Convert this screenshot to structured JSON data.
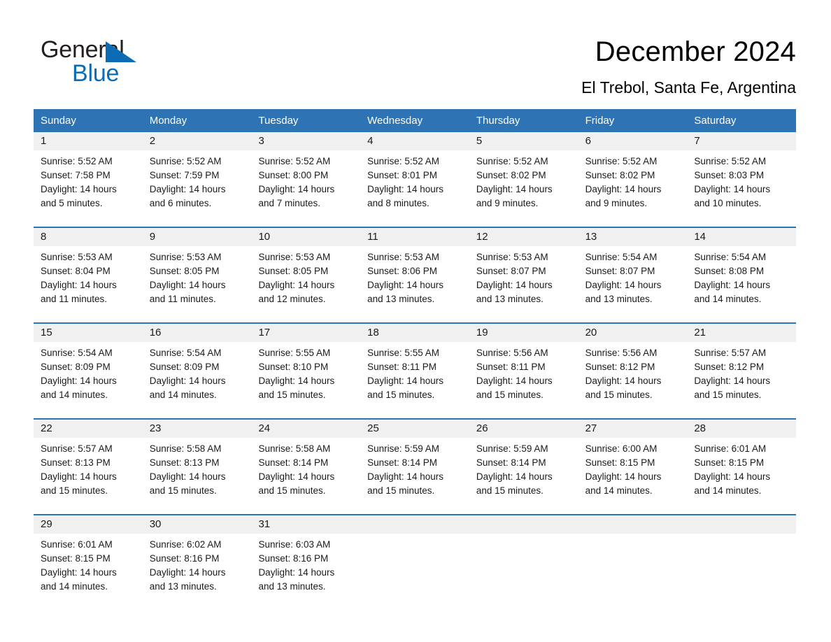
{
  "logo": {
    "text_top": "General",
    "text_bottom": "Blue",
    "triangle_icon": "blue-triangle-icon",
    "color_dark": "#231f20",
    "color_blue": "#0b6cb5"
  },
  "header": {
    "title": "December 2024",
    "subtitle": "El Trebol, Santa Fe, Argentina"
  },
  "theme": {
    "header_blue": "#2e74b5",
    "daynum_band": "#f0f0f0",
    "text": "#1a1a1a"
  },
  "calendar": {
    "weekdays": [
      "Sunday",
      "Monday",
      "Tuesday",
      "Wednesday",
      "Thursday",
      "Friday",
      "Saturday"
    ],
    "weeks": [
      {
        "days": [
          {
            "num": "1",
            "sunrise": "Sunrise: 5:52 AM",
            "sunset": "Sunset: 7:58 PM",
            "daylight1": "Daylight: 14 hours",
            "daylight2": "and 5 minutes."
          },
          {
            "num": "2",
            "sunrise": "Sunrise: 5:52 AM",
            "sunset": "Sunset: 7:59 PM",
            "daylight1": "Daylight: 14 hours",
            "daylight2": "and 6 minutes."
          },
          {
            "num": "3",
            "sunrise": "Sunrise: 5:52 AM",
            "sunset": "Sunset: 8:00 PM",
            "daylight1": "Daylight: 14 hours",
            "daylight2": "and 7 minutes."
          },
          {
            "num": "4",
            "sunrise": "Sunrise: 5:52 AM",
            "sunset": "Sunset: 8:01 PM",
            "daylight1": "Daylight: 14 hours",
            "daylight2": "and 8 minutes."
          },
          {
            "num": "5",
            "sunrise": "Sunrise: 5:52 AM",
            "sunset": "Sunset: 8:02 PM",
            "daylight1": "Daylight: 14 hours",
            "daylight2": "and 9 minutes."
          },
          {
            "num": "6",
            "sunrise": "Sunrise: 5:52 AM",
            "sunset": "Sunset: 8:02 PM",
            "daylight1": "Daylight: 14 hours",
            "daylight2": "and 9 minutes."
          },
          {
            "num": "7",
            "sunrise": "Sunrise: 5:52 AM",
            "sunset": "Sunset: 8:03 PM",
            "daylight1": "Daylight: 14 hours",
            "daylight2": "and 10 minutes."
          }
        ]
      },
      {
        "days": [
          {
            "num": "8",
            "sunrise": "Sunrise: 5:53 AM",
            "sunset": "Sunset: 8:04 PM",
            "daylight1": "Daylight: 14 hours",
            "daylight2": "and 11 minutes."
          },
          {
            "num": "9",
            "sunrise": "Sunrise: 5:53 AM",
            "sunset": "Sunset: 8:05 PM",
            "daylight1": "Daylight: 14 hours",
            "daylight2": "and 11 minutes."
          },
          {
            "num": "10",
            "sunrise": "Sunrise: 5:53 AM",
            "sunset": "Sunset: 8:05 PM",
            "daylight1": "Daylight: 14 hours",
            "daylight2": "and 12 minutes."
          },
          {
            "num": "11",
            "sunrise": "Sunrise: 5:53 AM",
            "sunset": "Sunset: 8:06 PM",
            "daylight1": "Daylight: 14 hours",
            "daylight2": "and 13 minutes."
          },
          {
            "num": "12",
            "sunrise": "Sunrise: 5:53 AM",
            "sunset": "Sunset: 8:07 PM",
            "daylight1": "Daylight: 14 hours",
            "daylight2": "and 13 minutes."
          },
          {
            "num": "13",
            "sunrise": "Sunrise: 5:54 AM",
            "sunset": "Sunset: 8:07 PM",
            "daylight1": "Daylight: 14 hours",
            "daylight2": "and 13 minutes."
          },
          {
            "num": "14",
            "sunrise": "Sunrise: 5:54 AM",
            "sunset": "Sunset: 8:08 PM",
            "daylight1": "Daylight: 14 hours",
            "daylight2": "and 14 minutes."
          }
        ]
      },
      {
        "days": [
          {
            "num": "15",
            "sunrise": "Sunrise: 5:54 AM",
            "sunset": "Sunset: 8:09 PM",
            "daylight1": "Daylight: 14 hours",
            "daylight2": "and 14 minutes."
          },
          {
            "num": "16",
            "sunrise": "Sunrise: 5:54 AM",
            "sunset": "Sunset: 8:09 PM",
            "daylight1": "Daylight: 14 hours",
            "daylight2": "and 14 minutes."
          },
          {
            "num": "17",
            "sunrise": "Sunrise: 5:55 AM",
            "sunset": "Sunset: 8:10 PM",
            "daylight1": "Daylight: 14 hours",
            "daylight2": "and 15 minutes."
          },
          {
            "num": "18",
            "sunrise": "Sunrise: 5:55 AM",
            "sunset": "Sunset: 8:11 PM",
            "daylight1": "Daylight: 14 hours",
            "daylight2": "and 15 minutes."
          },
          {
            "num": "19",
            "sunrise": "Sunrise: 5:56 AM",
            "sunset": "Sunset: 8:11 PM",
            "daylight1": "Daylight: 14 hours",
            "daylight2": "and 15 minutes."
          },
          {
            "num": "20",
            "sunrise": "Sunrise: 5:56 AM",
            "sunset": "Sunset: 8:12 PM",
            "daylight1": "Daylight: 14 hours",
            "daylight2": "and 15 minutes."
          },
          {
            "num": "21",
            "sunrise": "Sunrise: 5:57 AM",
            "sunset": "Sunset: 8:12 PM",
            "daylight1": "Daylight: 14 hours",
            "daylight2": "and 15 minutes."
          }
        ]
      },
      {
        "days": [
          {
            "num": "22",
            "sunrise": "Sunrise: 5:57 AM",
            "sunset": "Sunset: 8:13 PM",
            "daylight1": "Daylight: 14 hours",
            "daylight2": "and 15 minutes."
          },
          {
            "num": "23",
            "sunrise": "Sunrise: 5:58 AM",
            "sunset": "Sunset: 8:13 PM",
            "daylight1": "Daylight: 14 hours",
            "daylight2": "and 15 minutes."
          },
          {
            "num": "24",
            "sunrise": "Sunrise: 5:58 AM",
            "sunset": "Sunset: 8:14 PM",
            "daylight1": "Daylight: 14 hours",
            "daylight2": "and 15 minutes."
          },
          {
            "num": "25",
            "sunrise": "Sunrise: 5:59 AM",
            "sunset": "Sunset: 8:14 PM",
            "daylight1": "Daylight: 14 hours",
            "daylight2": "and 15 minutes."
          },
          {
            "num": "26",
            "sunrise": "Sunrise: 5:59 AM",
            "sunset": "Sunset: 8:14 PM",
            "daylight1": "Daylight: 14 hours",
            "daylight2": "and 15 minutes."
          },
          {
            "num": "27",
            "sunrise": "Sunrise: 6:00 AM",
            "sunset": "Sunset: 8:15 PM",
            "daylight1": "Daylight: 14 hours",
            "daylight2": "and 14 minutes."
          },
          {
            "num": "28",
            "sunrise": "Sunrise: 6:01 AM",
            "sunset": "Sunset: 8:15 PM",
            "daylight1": "Daylight: 14 hours",
            "daylight2": "and 14 minutes."
          }
        ]
      },
      {
        "days": [
          {
            "num": "29",
            "sunrise": "Sunrise: 6:01 AM",
            "sunset": "Sunset: 8:15 PM",
            "daylight1": "Daylight: 14 hours",
            "daylight2": "and 14 minutes."
          },
          {
            "num": "30",
            "sunrise": "Sunrise: 6:02 AM",
            "sunset": "Sunset: 8:16 PM",
            "daylight1": "Daylight: 14 hours",
            "daylight2": "and 13 minutes."
          },
          {
            "num": "31",
            "sunrise": "Sunrise: 6:03 AM",
            "sunset": "Sunset: 8:16 PM",
            "daylight1": "Daylight: 14 hours",
            "daylight2": "and 13 minutes."
          },
          {
            "num": "",
            "sunrise": "",
            "sunset": "",
            "daylight1": "",
            "daylight2": ""
          },
          {
            "num": "",
            "sunrise": "",
            "sunset": "",
            "daylight1": "",
            "daylight2": ""
          },
          {
            "num": "",
            "sunrise": "",
            "sunset": "",
            "daylight1": "",
            "daylight2": ""
          },
          {
            "num": "",
            "sunrise": "",
            "sunset": "",
            "daylight1": "",
            "daylight2": ""
          }
        ]
      }
    ]
  }
}
